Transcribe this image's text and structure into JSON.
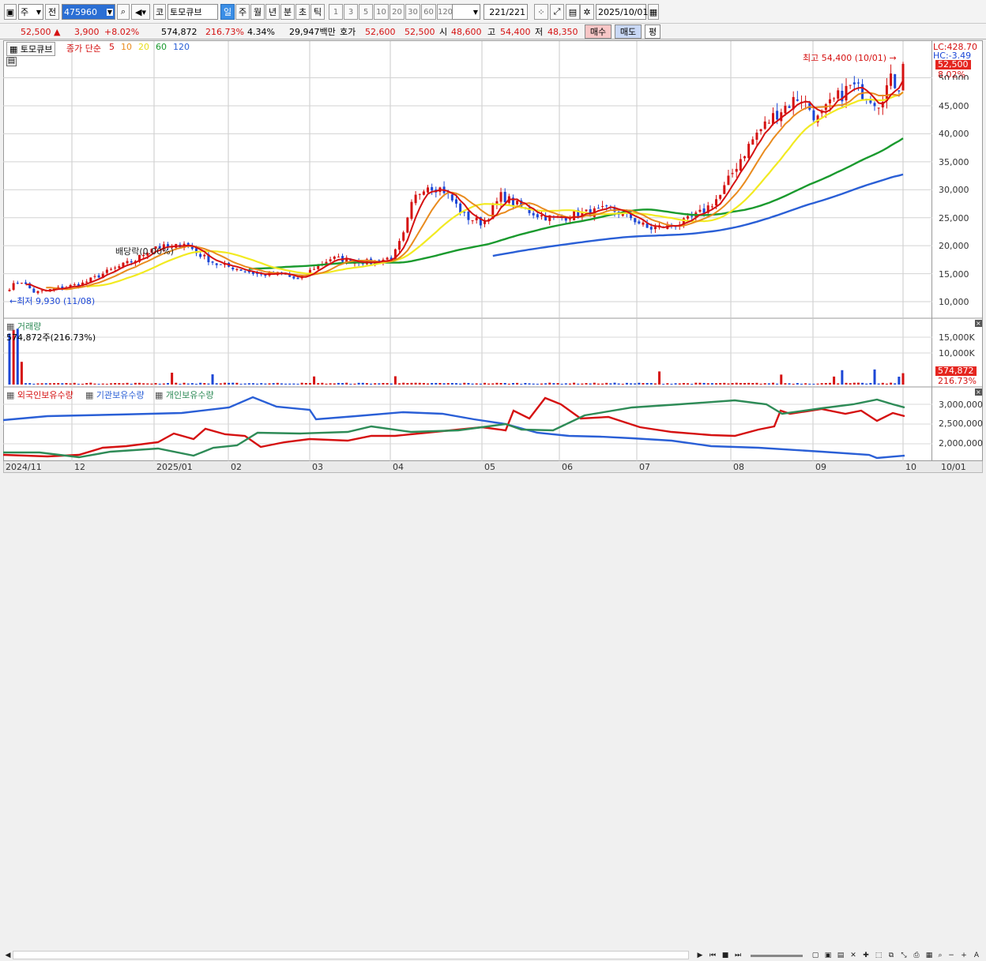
{
  "toolbar": {
    "type_label": "주",
    "prev_label": "전",
    "code": "475960",
    "name": "토모큐브",
    "market_label": "코",
    "periods": [
      {
        "l": "일",
        "sel": true
      },
      {
        "l": "주",
        "sel": false
      },
      {
        "l": "월",
        "sel": false
      },
      {
        "l": "년",
        "sel": false
      },
      {
        "l": "분",
        "sel": false
      },
      {
        "l": "초",
        "sel": false
      },
      {
        "l": "틱",
        "sel": false
      }
    ],
    "intervals": [
      "1",
      "3",
      "5",
      "10",
      "20",
      "30",
      "60",
      "120"
    ],
    "count": "221",
    "count_total": "/221",
    "date": "2025/10/01"
  },
  "quote": {
    "price": "52,500",
    "arrow": "▲",
    "change": "3,900",
    "rate": "+8.02%",
    "volume": "574,872",
    "vol_ratio": "216.73%",
    "turnover_pct": "4.34%",
    "amount": "29,947백만",
    "hoga_label": "호가",
    "ask": "52,600",
    "bid": "52,500",
    "open_label": "시",
    "open": "48,600",
    "high_label": "고",
    "high": "54,400",
    "low_label": "저",
    "low": "48,350",
    "buy_label": "매수",
    "sell_label": "매도",
    "avg_label": "평"
  },
  "price_panel": {
    "name_tag": "토모큐브",
    "ma_title": "종가 단순",
    "ma_periods": [
      {
        "l": "5",
        "c": "#d51111"
      },
      {
        "l": "10",
        "c": "#e98b1e"
      },
      {
        "l": "20",
        "c": "#e5dc1c"
      },
      {
        "l": "60",
        "c": "#1a9a2e"
      },
      {
        "l": "120",
        "c": "#2a5fd6"
      }
    ],
    "high_marker": "최고 54,400 (10/01)",
    "low_marker": "최저 9,930 (11/08)",
    "dividend_marker": "배당락(0.00%)",
    "lc": "LC:428.70",
    "hc": "HC:-3.49",
    "price_pill": "52,500",
    "rate_pill": "8.02%",
    "yticks": [
      "45,000",
      "40,000",
      "35,000",
      "30,000",
      "25,000",
      "20,000",
      "15,000",
      "10,000"
    ],
    "ytick_vals": [
      45000,
      40000,
      35000,
      30000,
      25000,
      20000,
      15000,
      10000
    ],
    "ytop_partial": "50,000"
  },
  "volume_panel": {
    "title": "거래량",
    "last": "574,872주(216.73%)",
    "yticks": [
      "15,000K",
      "10,000K"
    ],
    "pill": "574,872",
    "pill2": "216.73%"
  },
  "holding_panel": {
    "series": [
      {
        "name": "외국인보유수량",
        "c": "#d51111"
      },
      {
        "name": "기관보유수량",
        "c": "#2a5fd6"
      },
      {
        "name": "개인보유수량",
        "c": "#2e8b57"
      }
    ],
    "yticks": [
      "3,000,000",
      "2,500,000",
      "2,000,000"
    ]
  },
  "xaxis": [
    {
      "l": "2024/11",
      "x": 4
    },
    {
      "l": "12",
      "x": 91
    },
    {
      "l": "2025/01",
      "x": 195
    },
    {
      "l": "02",
      "x": 289
    },
    {
      "l": "03",
      "x": 392
    },
    {
      "l": "04",
      "x": 494
    },
    {
      "l": "05",
      "x": 610
    },
    {
      "l": "06",
      "x": 708
    },
    {
      "l": "07",
      "x": 806
    },
    {
      "l": "08",
      "x": 925
    },
    {
      "l": "09",
      "x": 1029
    },
    {
      "l": "10",
      "x": 1143
    },
    {
      "l": "10/01",
      "x": 1188
    }
  ],
  "colors": {
    "up": "#d51111",
    "down": "#1c47d6",
    "ma5": "#d51111",
    "ma10": "#e98b1e",
    "ma20": "#f2ea22",
    "ma60": "#1a9a2e",
    "ma120": "#2a5fd6"
  }
}
